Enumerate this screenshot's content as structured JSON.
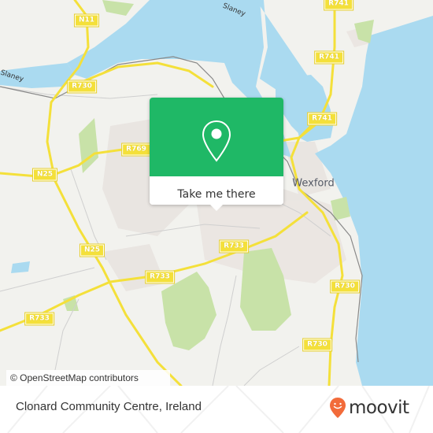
{
  "map": {
    "attribution": "© OpenStreetMap contributors",
    "place_labels": [
      {
        "id": "wexford",
        "text": "Wexford"
      }
    ],
    "river_labels": [
      {
        "id": "slaney-west",
        "text": "Slaney"
      },
      {
        "id": "slaney-north",
        "text": "Slaney"
      }
    ],
    "road_shields": [
      {
        "id": "n11",
        "text": "N11"
      },
      {
        "id": "r730-a",
        "text": "R730"
      },
      {
        "id": "r769",
        "text": "R769"
      },
      {
        "id": "n25-a",
        "text": "N25"
      },
      {
        "id": "n25-b",
        "text": "N25"
      },
      {
        "id": "r733-a",
        "text": "R733"
      },
      {
        "id": "r733-b",
        "text": "R733"
      },
      {
        "id": "r733-c",
        "text": "R733"
      },
      {
        "id": "r741-a",
        "text": "R741"
      },
      {
        "id": "r741-b",
        "text": "R741"
      },
      {
        "id": "r741-c",
        "text": "R741"
      },
      {
        "id": "r730-b",
        "text": "R730"
      },
      {
        "id": "r730-c",
        "text": "R730"
      }
    ],
    "colors": {
      "land": "#f2f2ee",
      "water": "#aadaf0",
      "park": "#c8e2a8",
      "urban": "#e8e2df",
      "road_major": "#f4e03a"
    }
  },
  "popup": {
    "icon": "location-pin-icon",
    "cta_label": "Take me there",
    "color": "#1fb866"
  },
  "footer": {
    "place_name": "Clonard Community Centre, Ireland",
    "brand": "moovit",
    "brand_color": "#f26b3a"
  }
}
